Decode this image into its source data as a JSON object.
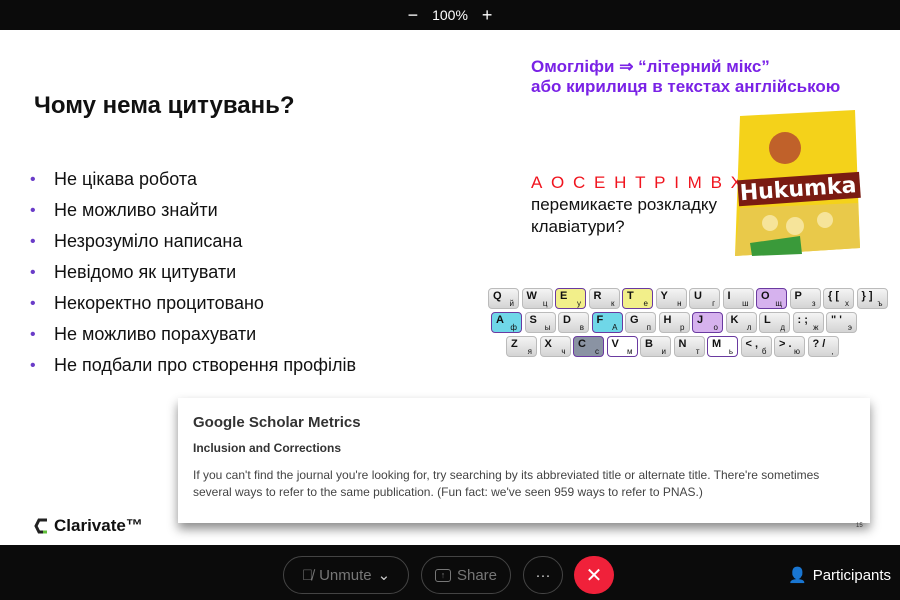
{
  "zoom": {
    "level": "100%",
    "minus": "−",
    "plus": "+"
  },
  "slide": {
    "title": "Чому нема цитувань?",
    "bullets": [
      "Не цікава робота",
      "Не можливо знайти",
      "Незрозуміло написана",
      "Невідомо як цитувати",
      "Некоректно процитовано",
      "Не можливо порахувати",
      "Не подбали про створення профілів"
    ],
    "homoglyph_line1": "Омогліфи ⇒ “літерний мікс”",
    "homoglyph_line2": "або кирилиця в текстах англійською",
    "letters": "А О С Е Н Т Р І М В Х",
    "letters_suffix": " -",
    "question_line1": "перемикаєте розкладку",
    "question_line2": "клавіатури?",
    "bag_brand": "Hukumka",
    "keyboard": [
      [
        [
          "Q",
          "й",
          ""
        ],
        [
          "W",
          "ц",
          ""
        ],
        [
          "E",
          "у",
          "#f2ef8a"
        ],
        [
          "R",
          "к",
          ""
        ],
        [
          "T",
          "е",
          "#f2ef8a"
        ],
        [
          "Y",
          "н",
          ""
        ],
        [
          "U",
          "г",
          ""
        ],
        [
          "I",
          "ш",
          ""
        ],
        [
          "O",
          "щ",
          "#d6b2ee"
        ],
        [
          "P",
          "з",
          ""
        ],
        [
          "{ [",
          "х",
          ""
        ],
        [
          "} ]",
          "ъ",
          ""
        ]
      ],
      [
        [
          "A",
          "ф",
          "#6fd7e8"
        ],
        [
          "S",
          "ы",
          ""
        ],
        [
          "D",
          "в",
          ""
        ],
        [
          "F",
          "А",
          "#6fd7e8"
        ],
        [
          "G",
          "п",
          ""
        ],
        [
          "H",
          "р",
          ""
        ],
        [
          "J",
          "о",
          "#d6b2ee"
        ],
        [
          "K",
          "л",
          ""
        ],
        [
          "L",
          "д",
          ""
        ],
        [
          ": ;",
          "ж",
          ""
        ],
        [
          "\" '",
          "э",
          ""
        ]
      ],
      [
        [
          "Z",
          "я",
          ""
        ],
        [
          "X",
          "ч",
          ""
        ],
        [
          "C",
          "с",
          "#8a93a3"
        ],
        [
          "V",
          "м",
          "#ffffff"
        ],
        [
          "B",
          "и",
          ""
        ],
        [
          "N",
          "т",
          ""
        ],
        [
          "M",
          "ь",
          "#ffffff"
        ],
        [
          "< ,",
          "б",
          ""
        ],
        [
          "> .",
          "ю",
          ""
        ],
        [
          "? /",
          ",",
          ""
        ]
      ]
    ],
    "gs_title": "Google Scholar Metrics",
    "gs_subtitle": "Inclusion and Corrections",
    "gs_text": "If you can't find the journal you're looking for, try searching by its abbreviated title or alternate title. There're sometimes several ways to refer to the same publication. (Fun fact: we've seen 959 ways to refer to PNAS.)",
    "page_number": "15",
    "logo": "Clarivate™"
  },
  "controls": {
    "unmute": "Unmute",
    "share": "Share",
    "more": "···",
    "participants": "Participants"
  },
  "colors": {
    "accent": "#7a22e6",
    "end": "#f0213a"
  }
}
